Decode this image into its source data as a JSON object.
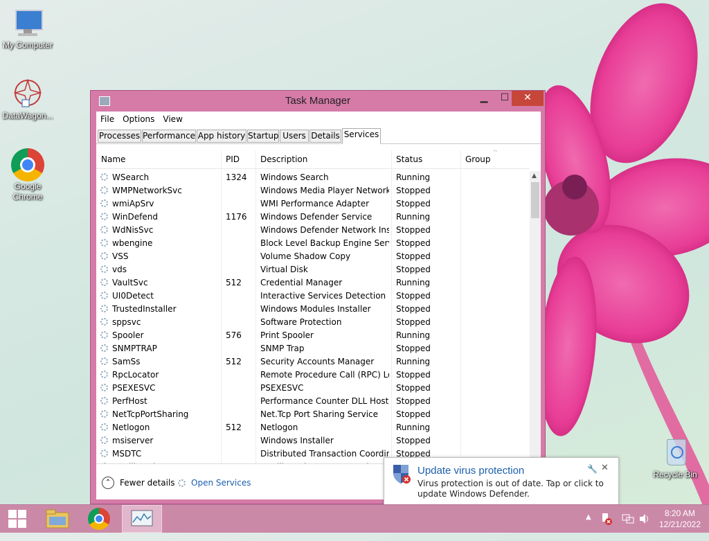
{
  "desktop": {
    "icons": [
      {
        "label": "My Computer"
      },
      {
        "label": "DataWagon..."
      },
      {
        "label": "Google Chrome"
      },
      {
        "label": "Recycle Bin"
      }
    ]
  },
  "window": {
    "title": "Task Manager",
    "controls": {
      "minimize": "▁",
      "maximize": "☐",
      "close": "✕"
    },
    "menu": [
      "File",
      "Options",
      "View"
    ],
    "tabs": [
      "Processes",
      "Performance",
      "App history",
      "Startup",
      "Users",
      "Details",
      "Services"
    ],
    "active_tab": "Services",
    "columns": [
      "Name",
      "PID",
      "Description",
      "Status",
      "Group"
    ],
    "rows": [
      {
        "name": "WSearch",
        "pid": "1324",
        "desc": "Windows Search",
        "status": "Running"
      },
      {
        "name": "WMPNetworkSvc",
        "pid": "",
        "desc": "Windows Media Player Network ...",
        "status": "Stopped"
      },
      {
        "name": "wmiApSrv",
        "pid": "",
        "desc": "WMI Performance Adapter",
        "status": "Stopped"
      },
      {
        "name": "WinDefend",
        "pid": "1176",
        "desc": "Windows Defender Service",
        "status": "Running"
      },
      {
        "name": "WdNisSvc",
        "pid": "",
        "desc": "Windows Defender Network Insp...",
        "status": "Stopped"
      },
      {
        "name": "wbengine",
        "pid": "",
        "desc": "Block Level Backup Engine Service",
        "status": "Stopped"
      },
      {
        "name": "VSS",
        "pid": "",
        "desc": "Volume Shadow Copy",
        "status": "Stopped"
      },
      {
        "name": "vds",
        "pid": "",
        "desc": "Virtual Disk",
        "status": "Stopped"
      },
      {
        "name": "VaultSvc",
        "pid": "512",
        "desc": "Credential Manager",
        "status": "Running"
      },
      {
        "name": "UI0Detect",
        "pid": "",
        "desc": "Interactive Services Detection",
        "status": "Stopped"
      },
      {
        "name": "TrustedInstaller",
        "pid": "",
        "desc": "Windows Modules Installer",
        "status": "Stopped"
      },
      {
        "name": "sppsvc",
        "pid": "",
        "desc": "Software Protection",
        "status": "Stopped"
      },
      {
        "name": "Spooler",
        "pid": "576",
        "desc": "Print Spooler",
        "status": "Running"
      },
      {
        "name": "SNMPTRAP",
        "pid": "",
        "desc": "SNMP Trap",
        "status": "Stopped"
      },
      {
        "name": "SamSs",
        "pid": "512",
        "desc": "Security Accounts Manager",
        "status": "Running"
      },
      {
        "name": "RpcLocator",
        "pid": "",
        "desc": "Remote Procedure Call (RPC) Lo...",
        "status": "Stopped"
      },
      {
        "name": "PSEXESVC",
        "pid": "",
        "desc": "PSEXESVC",
        "status": "Stopped"
      },
      {
        "name": "PerfHost",
        "pid": "",
        "desc": "Performance Counter DLL Host",
        "status": "Stopped"
      },
      {
        "name": "NetTcpPortSharing",
        "pid": "",
        "desc": "Net.Tcp Port Sharing Service",
        "status": "Stopped"
      },
      {
        "name": "Netlogon",
        "pid": "512",
        "desc": "Netlogon",
        "status": "Running"
      },
      {
        "name": "msiserver",
        "pid": "",
        "desc": "Windows Installer",
        "status": "Stopped"
      },
      {
        "name": "MSDTC",
        "pid": "",
        "desc": "Distributed Transaction Coordin...",
        "status": "Stopped"
      },
      {
        "name": "MozillaMaintenance",
        "pid": "",
        "desc": "Mozilla Maintenance Service",
        "status": "Stopped"
      }
    ],
    "footer": {
      "fewer_details": "Fewer details",
      "open_services": "Open Services"
    }
  },
  "notification": {
    "title": "Update virus protection",
    "body": "Virus protection is out of date. Tap or click to update Windows Defender.",
    "pin_icon": "wrench-icon",
    "close": "✕"
  },
  "taskbar": {
    "clock_time": "8:20 AM",
    "clock_date": "12/21/2022",
    "colors": {
      "bar": "#cb89a8",
      "window_frame": "#d67ba8",
      "close_button": "#c7463a",
      "link": "#1b5fae"
    }
  }
}
